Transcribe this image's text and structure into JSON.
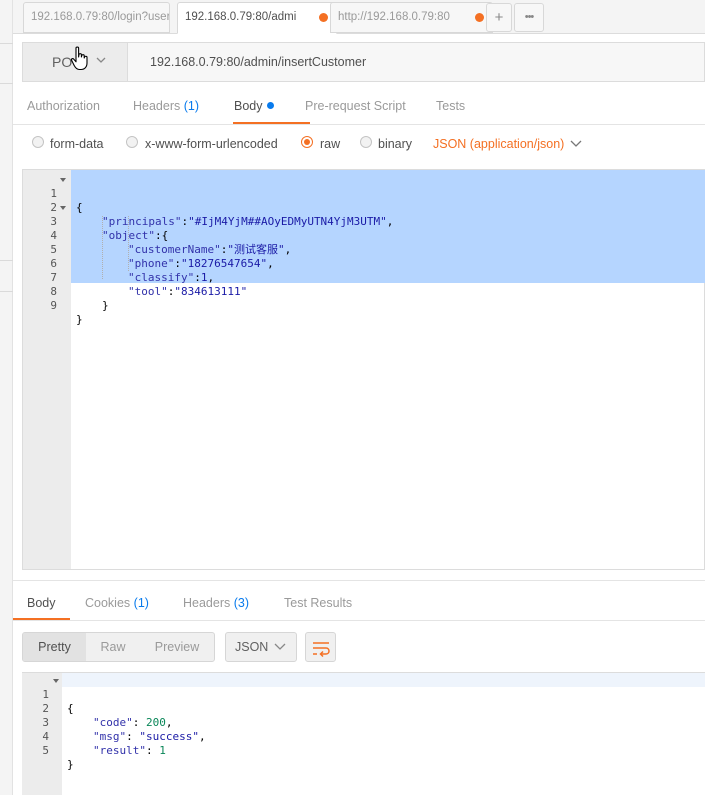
{
  "tabs": [
    {
      "title": "192.168.0.79:80/login?username",
      "active": false,
      "unsaved": false
    },
    {
      "title": "192.168.0.79:80/admi",
      "active": true,
      "unsaved": true
    },
    {
      "title": "http://192.168.0.79:80",
      "active": false,
      "unsaved": true
    }
  ],
  "tab_actions": {
    "add": "+",
    "more": "•••"
  },
  "request": {
    "method": "PO",
    "url": "192.168.0.79:80/admin/insertCustomer"
  },
  "request_tabs": {
    "authorization": "Authorization",
    "headers": "Headers",
    "headers_count": "(1)",
    "body": "Body",
    "prerequest": "Pre-request Script",
    "tests": "Tests"
  },
  "body_types": {
    "form_data": "form-data",
    "urlencoded": "x-www-form-urlencoded",
    "raw": "raw",
    "binary": "binary",
    "selected": "raw",
    "content_type": "JSON (application/json)"
  },
  "request_body": {
    "line_numbers": [
      "1",
      "2",
      "3",
      "4",
      "5",
      "6",
      "7",
      "8",
      "9"
    ],
    "l1": "{",
    "l2_key": "\"principals\"",
    "l2_val": "\"#IjM4YjM##AOyEDMyUTN4YjM3UTM\"",
    "l3_key": "\"object\"",
    "l3_rest": ":{",
    "l4_key": "\"customerName\"",
    "l4_val": "\"测试客服\"",
    "l5_key": "\"phone\"",
    "l5_val": "\"18276547654\"",
    "l6_key": "\"classify\"",
    "l6_val": "1",
    "l7_key": "\"tool\"",
    "l7_val": "\"834613111\"",
    "l8": "}",
    "l9": "}"
  },
  "response_tabs": {
    "body": "Body",
    "cookies": "Cookies",
    "cookies_count": "(1)",
    "headers": "Headers",
    "headers_count": "(3)",
    "test_results": "Test Results"
  },
  "response_view": {
    "pretty": "Pretty",
    "raw": "Raw",
    "preview": "Preview",
    "format": "JSON"
  },
  "response_body": {
    "line_numbers": [
      "1",
      "2",
      "3",
      "4",
      "5"
    ],
    "l1": "{",
    "code_key": "\"code\"",
    "code_val": "200",
    "msg_key": "\"msg\"",
    "msg_val": "\"success\"",
    "result_key": "\"result\"",
    "result_val": "1",
    "l5": "}"
  },
  "colors": {
    "accent": "#f47023",
    "link": "#097bed",
    "selection": "#b5d5ff"
  }
}
